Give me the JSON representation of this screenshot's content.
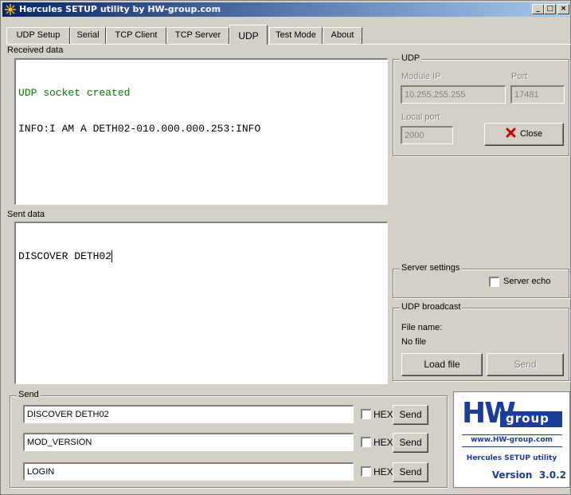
{
  "window": {
    "title": "Hercules SETUP utility by HW-group.com"
  },
  "tabs": [
    {
      "label": "UDP Setup"
    },
    {
      "label": "Serial"
    },
    {
      "label": "TCP Client"
    },
    {
      "label": "TCP Server"
    },
    {
      "label": "UDP"
    },
    {
      "label": "Test Mode"
    },
    {
      "label": "About"
    }
  ],
  "received": {
    "label": "Received data",
    "line1": "UDP socket created",
    "line2": "INFO:I AM A DETH02-010.000.000.253:INFO"
  },
  "sent": {
    "label": "Sent data",
    "line1": "DISCOVER DETH02"
  },
  "udp": {
    "title": "UDP",
    "module_ip_label": "Module IP",
    "module_ip": "10.255.255.255",
    "port_label": "Port",
    "port": "17481",
    "local_port_label": "Local port",
    "local_port": "2000",
    "close_label": "Close"
  },
  "server_settings": {
    "title": "Server settings",
    "server_echo_label": "Server echo"
  },
  "broadcast": {
    "title": "UDP broadcast",
    "file_name_label": "File name:",
    "file_name": "No file",
    "load_label": "Load file",
    "send_label": "Send"
  },
  "send": {
    "title": "Send",
    "rows": [
      {
        "value": "DISCOVER DETH02",
        "hex_label": "HEX",
        "send_label": "Send"
      },
      {
        "value": "MOD_VERSION",
        "hex_label": "HEX",
        "send_label": "Send"
      },
      {
        "value": "LOGIN",
        "hex_label": "HEX",
        "send_label": "Send"
      }
    ]
  },
  "logo": {
    "brand_hw": "HW",
    "brand_group": "group",
    "url": "www.HW-group.com",
    "product": "Hercules SETUP utility",
    "version": "Version  3.0.2"
  },
  "colors": {
    "received_highlight": "#008000",
    "close_x": "#cc0000",
    "titlebar": "#0a246a",
    "logo_blue": "#1a3c9c"
  }
}
